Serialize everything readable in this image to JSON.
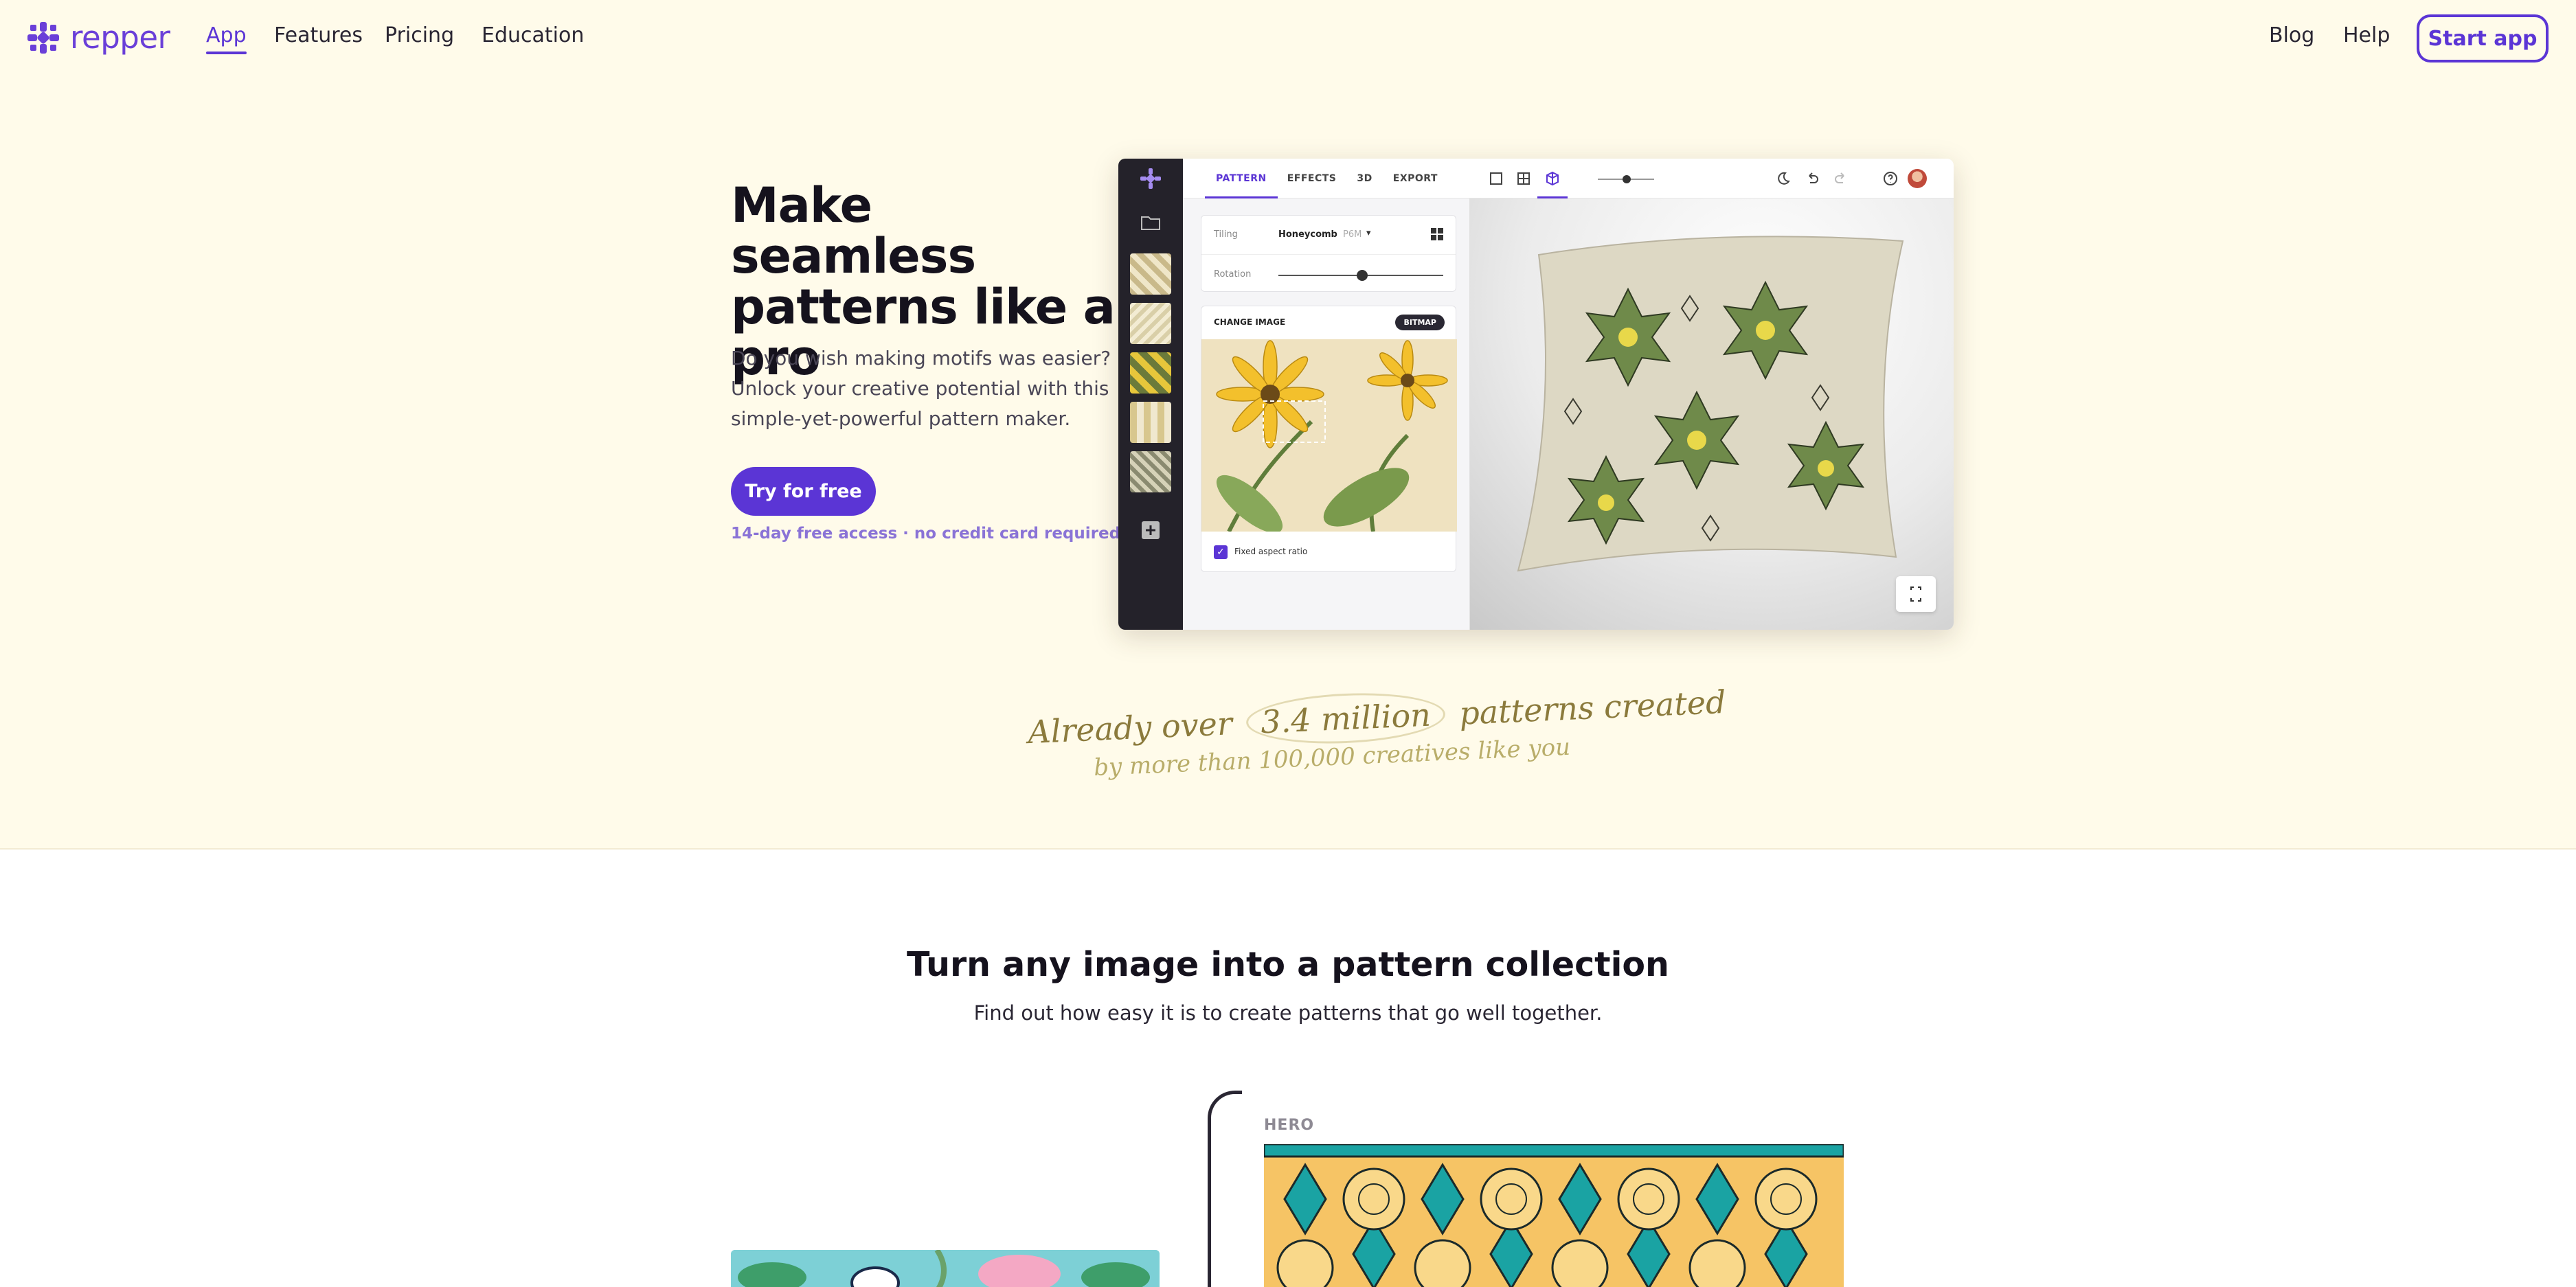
{
  "brand": {
    "name": "repper",
    "accent": "#5b35d5"
  },
  "nav": {
    "links": [
      "App",
      "Features",
      "Pricing",
      "Education"
    ],
    "right_links": [
      "Blog",
      "Help"
    ],
    "cta": "Start app"
  },
  "hero": {
    "title": "Make seamless patterns like a pro",
    "subtitle": "Do you wish making motifs was easier? Unlock your creative potential with this simple-yet-powerful pattern maker.",
    "cta": "Try for free",
    "note": "14-day free access · no credit card required"
  },
  "app_mock": {
    "tabs": [
      "PATTERN",
      "EFFECTS",
      "3D",
      "EXPORT"
    ],
    "tiling_label": "Tiling",
    "tiling_value": "Honeycomb",
    "tiling_code": "P6M",
    "rotation_label": "Rotation",
    "change_image": "CHANGE IMAGE",
    "bitmap": "BITMAP",
    "fixed_aspect": "Fixed aspect ratio"
  },
  "stats": {
    "prefix": "Already over",
    "highlight": "3.4 million",
    "suffix": "patterns created",
    "line2": "by more than 100,000 creatives like you"
  },
  "section": {
    "title": "Turn any image into a pattern collection",
    "subtitle": "Find out how easy it is to create patterns that go well together.",
    "hero_label": "HERO"
  }
}
